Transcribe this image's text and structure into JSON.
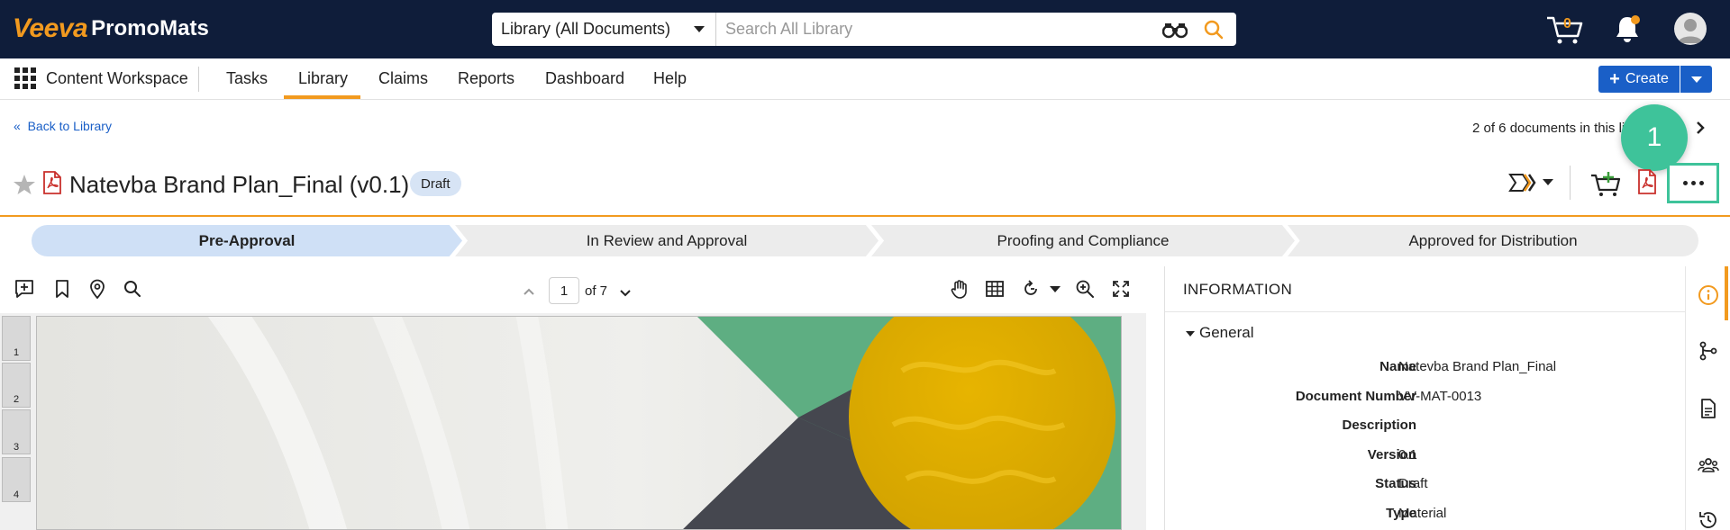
{
  "app": {
    "brand_veeva": "Veeva",
    "brand_product": "PromoMats"
  },
  "search": {
    "scope": "Library (All Documents)",
    "placeholder": "Search All Library"
  },
  "header_right": {
    "cart_count": "0"
  },
  "nav": {
    "workspace": "Content Workspace",
    "items": [
      "Tasks",
      "Library",
      "Claims",
      "Reports",
      "Dashboard",
      "Help"
    ],
    "active": "Library",
    "create_label": "Create"
  },
  "doc": {
    "back_label": "Back to Library",
    "back_chevrons": "«",
    "position_text": "2 of 6 documents in this li",
    "step_marker": "1",
    "title": "Natevba Brand Plan_Final (v0.1)",
    "status_badge": "Draft"
  },
  "lifecycle": {
    "stages": [
      "Pre-Approval",
      "In Review and Approval",
      "Proofing and Compliance",
      "Approved for Distribution"
    ],
    "current": "Pre-Approval"
  },
  "viewer": {
    "current_page": "1",
    "of_pages": "of 7",
    "thumbnails": [
      "1",
      "2",
      "3",
      "4"
    ]
  },
  "info_panel": {
    "title": "INFORMATION",
    "section": "General",
    "fields": [
      {
        "label": "Name",
        "value": "Natevba Brand Plan_Final"
      },
      {
        "label": "Document Number",
        "value": "VV-MAT-0013"
      },
      {
        "label": "Description",
        "value": ""
      },
      {
        "label": "Version",
        "value": "0.1"
      },
      {
        "label": "Status",
        "value": "Draft"
      },
      {
        "label": "Type",
        "value": "Material"
      }
    ]
  },
  "colors": {
    "topbar": "#0f1d3a",
    "accent_orange": "#f29a1f",
    "primary_blue": "#1a5fc7",
    "highlight_green": "#3ec39a",
    "stage_active": "#cfe0f6",
    "stage_inactive": "#ececec"
  },
  "icons": [
    "binoculars-icon",
    "search-icon",
    "cart-icon",
    "bell-icon",
    "avatar",
    "apps-grid-icon",
    "star-icon",
    "pdf-icon",
    "workflow-icon",
    "add-to-cart-icon",
    "more-icon",
    "add-annotation-icon",
    "bookmark-icon",
    "pin-icon",
    "hand-icon",
    "grid-icon",
    "rotate-icon",
    "zoom-in-icon",
    "fullscreen-icon",
    "info-icon",
    "relationships-icon",
    "document-icon",
    "users-icon",
    "history-icon"
  ]
}
